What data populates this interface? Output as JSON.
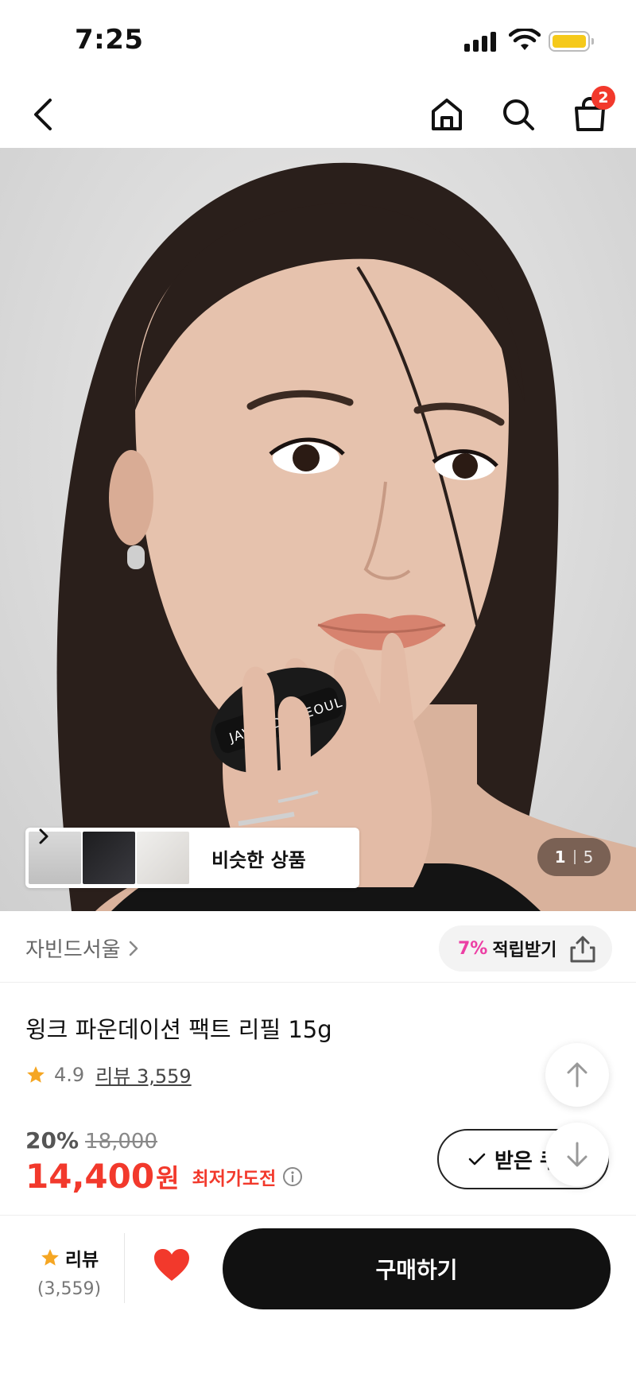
{
  "status_bar": {
    "time": "7:25"
  },
  "nav": {
    "cart_count": "2"
  },
  "hero": {
    "pad_text": "JAVIN DE SEOUL",
    "similar_label": "비슷한 상품",
    "pager_current": "1",
    "pager_total": "5"
  },
  "brand": {
    "name": "자빈드서울",
    "points_pct": "7%",
    "points_label": "적립받기"
  },
  "product": {
    "title": "윙크 파운데이션 팩트 리필 15g",
    "rating": "4.9",
    "review_link": "리뷰 3,559",
    "discount": "20%",
    "original_price": "18,000",
    "sale_price": "14,400",
    "currency": "원",
    "lowest_price_label": "최저가도전",
    "coupon_label": "받은 쿠"
  },
  "bottom_bar": {
    "review_label": "리뷰",
    "review_count": "(3,559)",
    "buy_label": "구매하기"
  },
  "colors": {
    "accent_red": "#f2392c",
    "points_pink": "#ec3fa4",
    "star": "#f5a623",
    "battery": "#f5c91a"
  }
}
